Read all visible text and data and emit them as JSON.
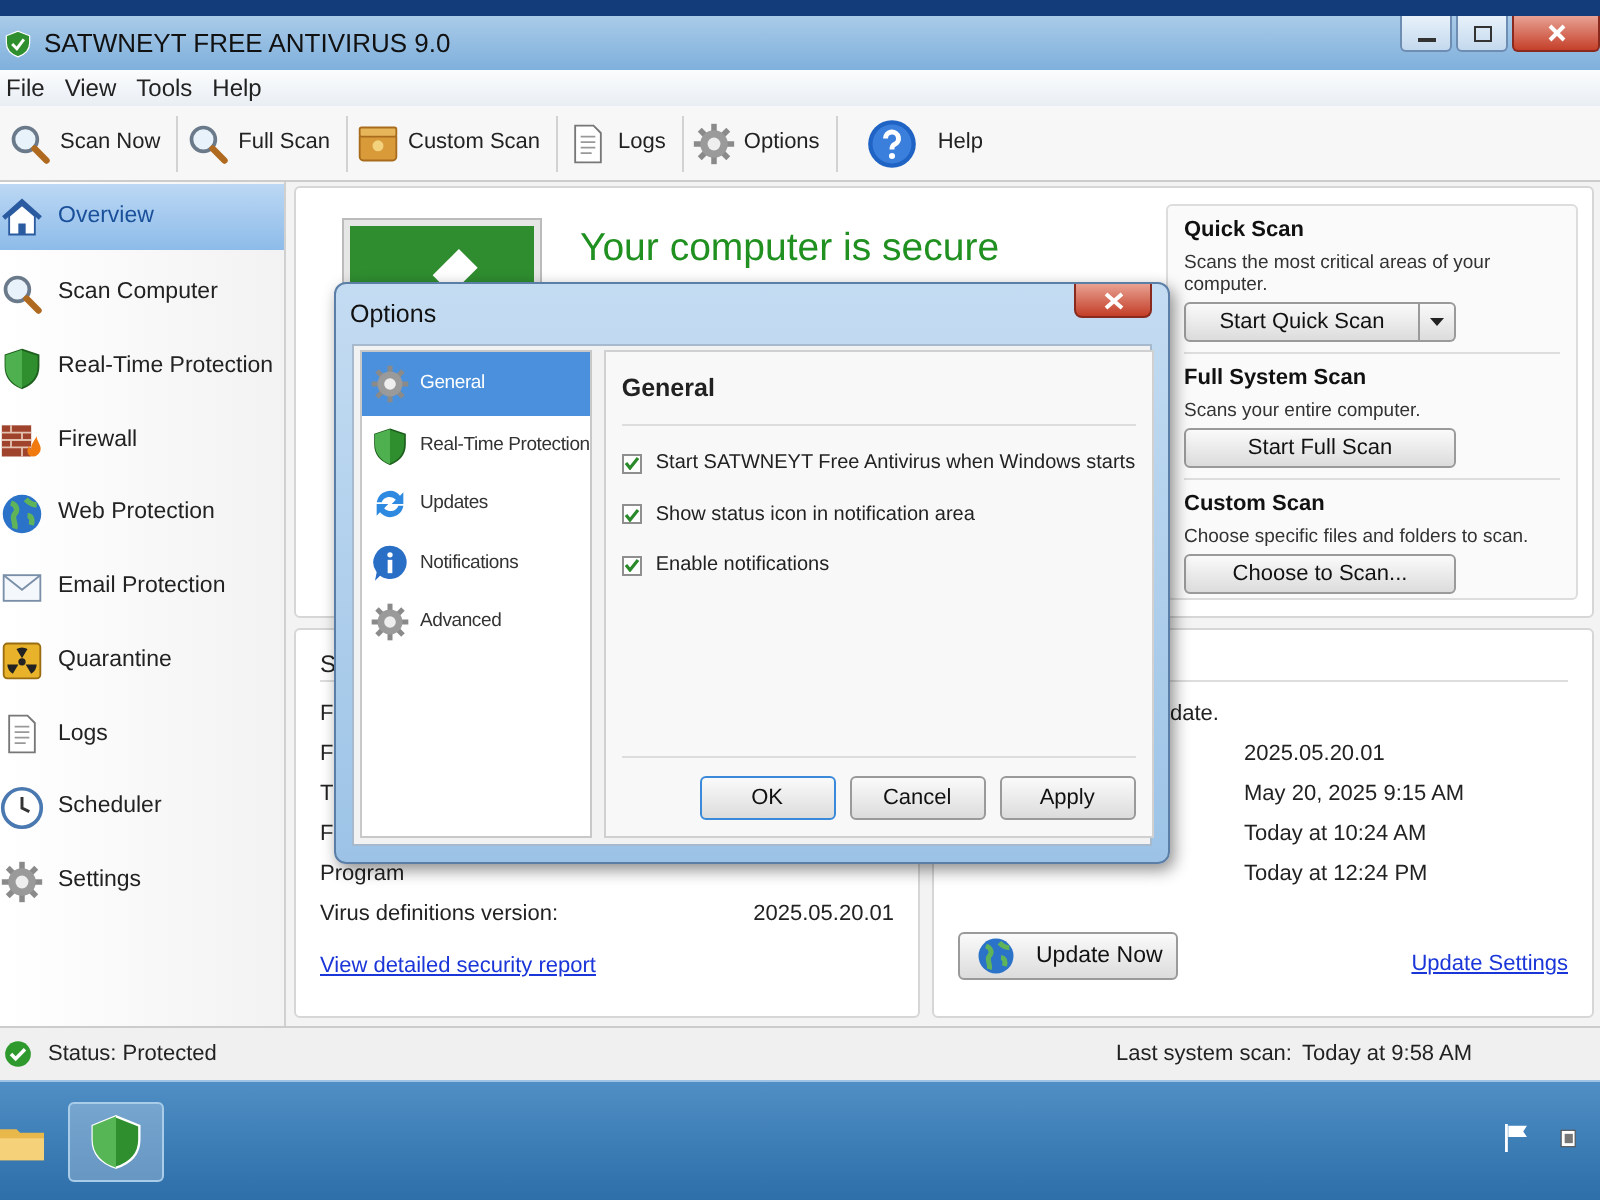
{
  "window": {
    "title": "SATWNEYT FREE ANTIVIRUS 9.0"
  },
  "menu": [
    {
      "label": "File"
    },
    {
      "label": "View"
    },
    {
      "label": "Tools"
    },
    {
      "label": "Help"
    }
  ],
  "toolbar": [
    {
      "label": "Scan Now",
      "kind": "magnifier"
    },
    {
      "label": "Full Scan",
      "kind": "magnifier"
    },
    {
      "label": "Custom Scan",
      "kind": "box"
    },
    {
      "label": "Logs",
      "kind": "document"
    },
    {
      "label": "Options",
      "kind": "gear"
    },
    {
      "label": "Help",
      "kind": "help"
    }
  ],
  "sidebar": {
    "items": [
      {
        "label": "Overview",
        "kind": "home",
        "selected": true
      },
      {
        "label": "Scan Computer",
        "kind": "magnifier",
        "selected": false
      },
      {
        "label": "Real-Time Protection",
        "kind": "shield",
        "selected": false
      },
      {
        "label": "Firewall",
        "kind": "firewall",
        "selected": false
      },
      {
        "label": "Web Protection",
        "kind": "globe",
        "selected": false
      },
      {
        "label": "Email Protection",
        "kind": "mail",
        "selected": false
      },
      {
        "label": "Quarantine",
        "kind": "hazard",
        "selected": false
      },
      {
        "label": "Logs",
        "kind": "document",
        "selected": false
      },
      {
        "label": "Scheduler",
        "kind": "clock",
        "selected": false
      },
      {
        "label": "Settings",
        "kind": "gear",
        "selected": false
      }
    ]
  },
  "overview": {
    "headline": "Your computer is secure"
  },
  "scans": [
    {
      "title": "Quick Scan",
      "description": "Scans the most critical areas of your computer.",
      "button": "Start Quick Scan",
      "dropdown": true
    },
    {
      "title": "Full System Scan",
      "description": "Scans your entire computer.",
      "button": "Start Full Scan",
      "dropdown": false
    },
    {
      "title": "Custom Scan",
      "description": "Choose specific files and folders to scan.",
      "button": "Choose to Scan...",
      "dropdown": false
    }
  ],
  "summary": {
    "heading": "S",
    "rows": [
      {
        "label": "F"
      },
      {
        "label": "F"
      },
      {
        "label": "T"
      },
      {
        "label": "F"
      },
      {
        "label": "Program"
      },
      {
        "label": "Virus definitions version:",
        "value": "2025.05.20.01"
      }
    ],
    "link": "View detailed security report"
  },
  "updates": {
    "note": "date.",
    "values": [
      "2025.05.20.01",
      "May 20, 2025 9:15 AM",
      "Today at 10:24 AM",
      "Today at 12:24 PM"
    ],
    "button": "Update Now",
    "link": "Update Settings"
  },
  "status_bar": {
    "status": "Status: Protected",
    "last_scan_label": "Last system scan:",
    "last_scan_value": "Today at 9:58 AM"
  },
  "dialog": {
    "title": "Options",
    "categories": [
      {
        "label": "General",
        "kind": "gear",
        "selected": true
      },
      {
        "label": "Real-Time Protection",
        "kind": "shield",
        "selected": false
      },
      {
        "label": "Updates",
        "kind": "refresh",
        "selected": false
      },
      {
        "label": "Notifications",
        "kind": "info",
        "selected": false
      },
      {
        "label": "Advanced",
        "kind": "gear",
        "selected": false
      }
    ],
    "heading": "General",
    "options": [
      {
        "label": "Start SATWNEYT Free Antivirus when Windows starts",
        "checked": true
      },
      {
        "label": "Show status icon in notification area",
        "checked": true
      },
      {
        "label": "Enable notifications",
        "checked": true
      }
    ],
    "buttons": [
      {
        "label": "OK",
        "default": true
      },
      {
        "label": "Cancel",
        "default": false
      },
      {
        "label": "Apply",
        "default": false
      }
    ]
  }
}
